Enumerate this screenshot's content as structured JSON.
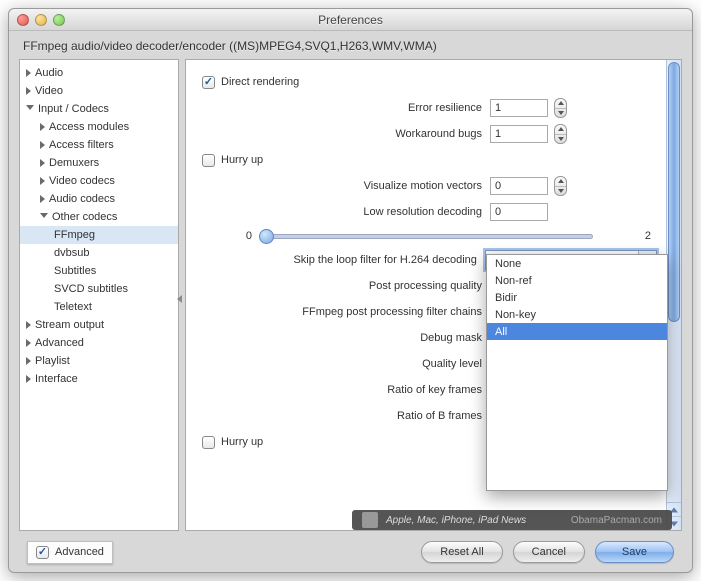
{
  "window": {
    "title": "Preferences",
    "subtitle": "FFmpeg audio/video decoder/encoder ((MS)MPEG4,SVQ1,H263,WMV,WMA)"
  },
  "sidebar": {
    "items": [
      {
        "label": "Audio",
        "level": 0,
        "open": false
      },
      {
        "label": "Video",
        "level": 0,
        "open": false
      },
      {
        "label": "Input / Codecs",
        "level": 0,
        "open": true
      },
      {
        "label": "Access modules",
        "level": 1,
        "open": false
      },
      {
        "label": "Access filters",
        "level": 1,
        "open": false
      },
      {
        "label": "Demuxers",
        "level": 1,
        "open": false
      },
      {
        "label": "Video codecs",
        "level": 1,
        "open": false
      },
      {
        "label": "Audio codecs",
        "level": 1,
        "open": false
      },
      {
        "label": "Other codecs",
        "level": 1,
        "open": true
      },
      {
        "label": "FFmpeg",
        "level": 2,
        "selected": true
      },
      {
        "label": "dvbsub",
        "level": 2
      },
      {
        "label": "Subtitles",
        "level": 2
      },
      {
        "label": "SVCD subtitles",
        "level": 2
      },
      {
        "label": "Teletext",
        "level": 2
      },
      {
        "label": "Stream output",
        "level": 0,
        "open": false
      },
      {
        "label": "Advanced",
        "level": 0,
        "open": false
      },
      {
        "label": "Playlist",
        "level": 0,
        "open": false
      },
      {
        "label": "Interface",
        "level": 0,
        "open": false
      }
    ]
  },
  "form": {
    "direct_rendering": {
      "label": "Direct rendering",
      "checked": true
    },
    "error_resilience": {
      "label": "Error resilience",
      "value": "1"
    },
    "workaround_bugs": {
      "label": "Workaround bugs",
      "value": "1"
    },
    "hurry_up1": {
      "label": "Hurry up",
      "checked": false
    },
    "visualize_motion": {
      "label": "Visualize motion vectors",
      "value": "0"
    },
    "low_res_decoding": {
      "label": "Low resolution decoding",
      "value": "0"
    },
    "slider": {
      "min": "0",
      "max": "2",
      "value": 0
    },
    "skip_loop": {
      "label": "Skip the loop filter for H.264 decoding",
      "value": "All"
    },
    "post_processing_quality": {
      "label": "Post processing quality"
    },
    "ffmpeg_pp_chains": {
      "label": "FFmpeg post processing filter chains"
    },
    "debug_mask": {
      "label": "Debug mask"
    },
    "quality_level": {
      "label": "Quality level"
    },
    "ratio_key": {
      "label": "Ratio of key frames"
    },
    "ratio_b": {
      "label": "Ratio of B frames"
    },
    "hurry_up2": {
      "label": "Hurry up",
      "checked": false
    }
  },
  "dropdown": {
    "options": [
      "None",
      "Non-ref",
      "Bidir",
      "Non-key",
      "All"
    ],
    "selected": "All"
  },
  "footer": {
    "advanced_label": "Advanced",
    "advanced_checked": true,
    "reset": "Reset All",
    "cancel": "Cancel",
    "save": "Save"
  },
  "banner": {
    "text": "Apple, Mac, iPhone, iPad News",
    "site": "ObamaPacman.com"
  }
}
